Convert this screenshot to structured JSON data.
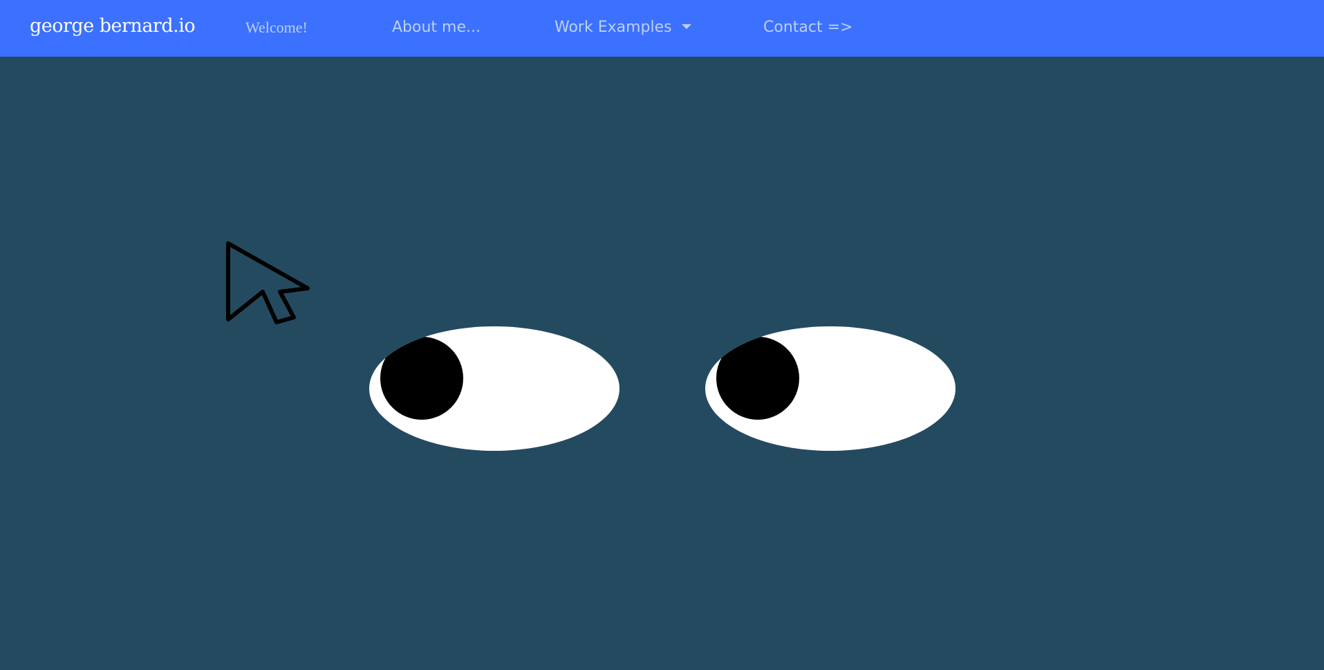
{
  "header": {
    "brand": "george bernard.io",
    "nav": {
      "welcome": "Welcome!",
      "about": "About me...",
      "work": "Work Examples",
      "contact": "Contact =>"
    }
  },
  "icons": {
    "cursor": "cursor-arrow-icon",
    "dropdown": "caret-down-icon"
  },
  "colors": {
    "navbar": "#3b71fe",
    "background": "#244a60",
    "nav_text": "#bcd0f6",
    "brand_text": "#ffffff"
  }
}
